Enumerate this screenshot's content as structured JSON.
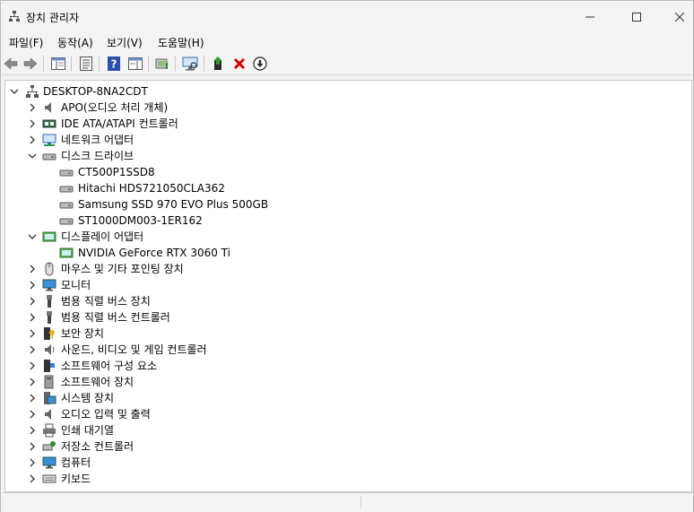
{
  "window": {
    "title": "장치 관리자"
  },
  "menu": [
    "파일(F)",
    "동작(A)",
    "보기(V)",
    "도움말(H)"
  ],
  "tree": {
    "root": "DESKTOP-8NA2CDT",
    "categories": [
      {
        "label": "APO(오디오 처리 개체)",
        "icon": "speaker-icon",
        "expanded": false
      },
      {
        "label": "IDE ATA/ATAPI 컨트롤러",
        "icon": "ide-controller-icon",
        "expanded": false
      },
      {
        "label": "네트워크 어댑터",
        "icon": "network-adapter-icon",
        "expanded": false
      },
      {
        "label": "디스크 드라이브",
        "icon": "disk-drive-icon",
        "expanded": true,
        "children": [
          "CT500P1SSD8",
          "Hitachi HDS721050CLA362",
          "Samsung SSD 970 EVO Plus 500GB",
          "ST1000DM003-1ER162"
        ]
      },
      {
        "label": "디스플레이 어댑터",
        "icon": "display-adapter-icon",
        "expanded": true,
        "children": [
          "NVIDIA GeForce RTX 3060 Ti"
        ]
      },
      {
        "label": "마우스 및 기타 포인팅 장치",
        "icon": "mouse-icon",
        "expanded": false
      },
      {
        "label": "모니터",
        "icon": "monitor-icon",
        "expanded": false
      },
      {
        "label": "범용 직렬 버스 장치",
        "icon": "usb-icon",
        "expanded": false
      },
      {
        "label": "범용 직렬 버스 컨트롤러",
        "icon": "usb-controller-icon",
        "expanded": false
      },
      {
        "label": "보안 장치",
        "icon": "security-device-icon",
        "expanded": false
      },
      {
        "label": "사운드, 비디오 및 게임 컨트롤러",
        "icon": "sound-icon",
        "expanded": false
      },
      {
        "label": "소프트웨어 구성 요소",
        "icon": "software-component-icon",
        "expanded": false
      },
      {
        "label": "소프트웨어 장치",
        "icon": "software-device-icon",
        "expanded": false
      },
      {
        "label": "시스템 장치",
        "icon": "system-device-icon",
        "expanded": false
      },
      {
        "label": "오디오 입력 및 출력",
        "icon": "audio-io-icon",
        "expanded": false
      },
      {
        "label": "인쇄 대기열",
        "icon": "printer-icon",
        "expanded": false
      },
      {
        "label": "저장소 컨트롤러",
        "icon": "storage-controller-icon",
        "expanded": false
      },
      {
        "label": "컴퓨터",
        "icon": "computer-icon",
        "expanded": false
      },
      {
        "label": "키보드",
        "icon": "keyboard-icon",
        "expanded": false
      }
    ]
  },
  "toolbar": [
    "back-icon",
    "forward-icon",
    "show-hide-tree-icon",
    "properties-icon",
    "help-icon",
    "action-pane-icon",
    "update-driver-icon",
    "scan-hardware-icon",
    "add-driver-icon",
    "uninstall-icon",
    "disable-icon"
  ]
}
